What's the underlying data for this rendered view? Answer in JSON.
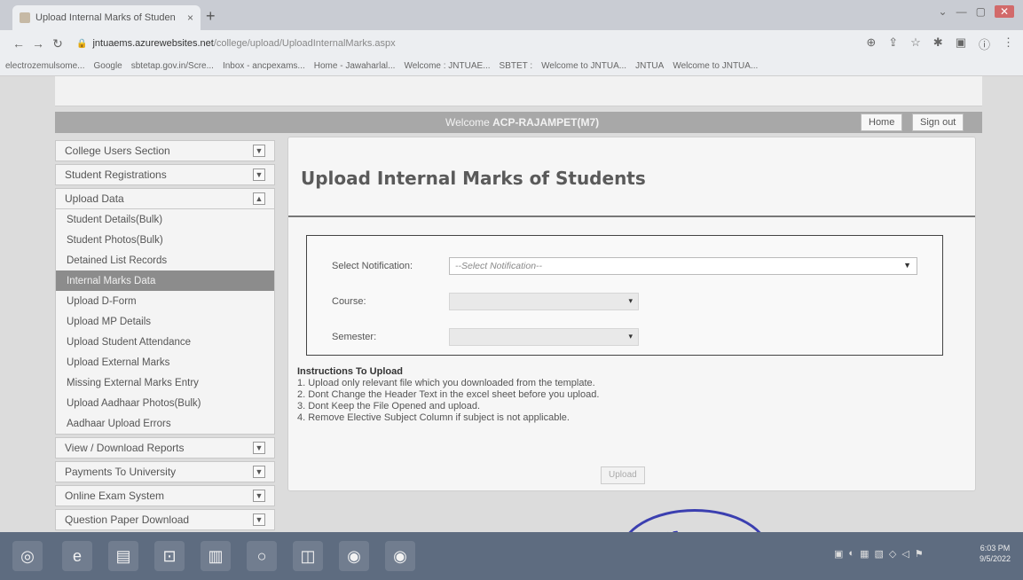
{
  "browser": {
    "tab_title": "Upload Internal Marks of Studen",
    "tab_close": "×",
    "new_tab": "+",
    "url_host": "jntuaems.azurewebsites.net",
    "url_path": "/college/upload/UploadInternalMarks.aspx",
    "bookmarks": [
      "electrozemulsome...",
      "Google",
      "sbtetap.gov.in/Scre...",
      "Inbox - ancpexams...",
      "Home - Jawaharlal...",
      "Welcome : JNTUAE...",
      "SBTET :",
      "Welcome to JNTUA...",
      "JNTUA",
      "Welcome to JNTUA..."
    ]
  },
  "header": {
    "welcome_prefix": "Welcome",
    "welcome_user": "ACP-RAJAMPET(M7)",
    "home_label": "Home",
    "signout_label": "Sign out"
  },
  "sidebar": {
    "sections": [
      {
        "label": "College Users Section"
      },
      {
        "label": "Student Registrations"
      },
      {
        "label": "Upload Data"
      }
    ],
    "upload_items": [
      "Student Details(Bulk)",
      "Student Photos(Bulk)",
      "Detained List Records",
      "Internal Marks Data",
      "Upload D-Form",
      "Upload MP Details",
      "Upload Student Attendance",
      "Upload External Marks",
      "Missing External Marks Entry",
      "Upload Aadhaar Photos(Bulk)",
      "Aadhaar Upload Errors"
    ],
    "bottom_sections": [
      "View / Download Reports",
      "Payments To University",
      "Online Exam System",
      "Question Paper Download"
    ]
  },
  "main": {
    "page_title": "Upload Internal Marks of Students",
    "notification_label": "Select Notification:",
    "notification_value": "--Select Notification--",
    "course_label": "Course:",
    "semester_label": "Semester:",
    "instructions_title": "Instructions To Upload",
    "instructions": [
      "1. Upload only relevant file which you downloaded from the template.",
      "2. Dont Change the Header Text in the excel sheet before you upload.",
      "3. Dont Keep the File Opened and upload.",
      "4. Remove Elective Subject Column if subject is not applicable."
    ],
    "upload_label": "Upload"
  },
  "stamp_text": "RYA COLLEGE",
  "clock": {
    "time": "6:03 PM",
    "date": "9/5/2022"
  }
}
